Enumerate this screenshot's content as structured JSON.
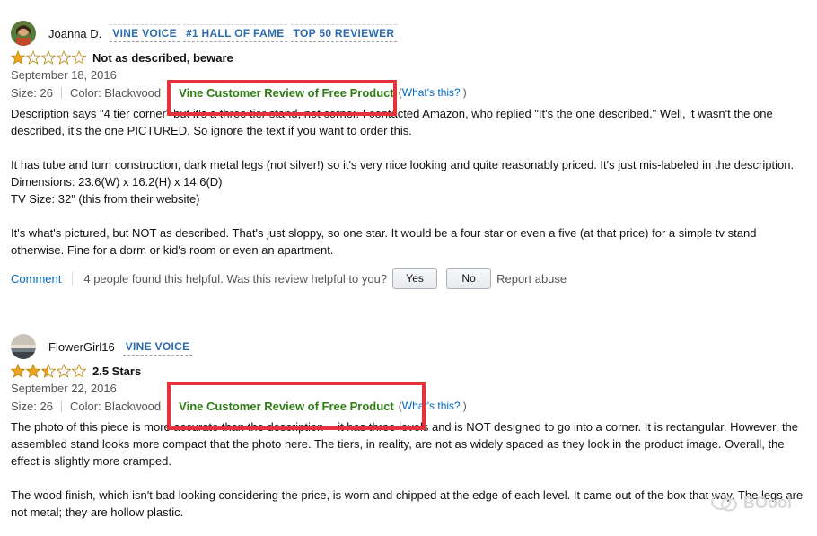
{
  "reviews": [
    {
      "username": "Joanna D.",
      "badges": [
        "VINE VOICE",
        "#1 HALL OF FAME",
        "TOP 50 REVIEWER"
      ],
      "rating": 1,
      "title": "Not as described, beware",
      "date": "September 18, 2016",
      "size": "Size: 26",
      "color": "Color: Blackwood",
      "vine_label": "Vine Customer Review of Free Product",
      "whats_this": "What's this?",
      "paragraphs": [
        "Description says \"4 tier corner\" but it's a three tier stand, not corner. I contacted Amazon, who replied \"It's the one described.\" Well, it wasn't the one described, it's the one PICTURED. So ignore the text if you want to order this.",
        "",
        "It has tube and turn construction, dark metal legs (not silver!) so it's very nice looking and quite reasonably priced. It's just mis-labeled in the description.",
        "Dimensions: 23.6(W) x 16.2(H) x 14.6(D)",
        "TV Size: 32\" (this from their website)",
        "",
        "It's what's pictured, but NOT as described. That's just sloppy, so one star. It would be a four star or even a five (at that price) for a simple tv stand otherwise. Fine for a dorm or kid's room or even an apartment."
      ],
      "comment": "Comment",
      "helpful_text": "4 people found this helpful. Was this review helpful to you?",
      "yes": "Yes",
      "no": "No",
      "report": "Report abuse"
    },
    {
      "username": "FlowerGirl16",
      "badges": [
        "VINE VOICE"
      ],
      "rating": 2.5,
      "title": "2.5 Stars",
      "date": "September 22, 2016",
      "size": "Size: 26",
      "color": "Color: Blackwood",
      "vine_label": "Vine Customer Review of Free Product",
      "whats_this": "What's this?",
      "paragraphs": [
        "The photo of this piece is more accurate than the description -- it has three levels and is NOT designed to go into a corner. It is rectangular. However, the assembled stand looks more compact that the photo here. The tiers, in reality, are not as widely spaced as they look in the product image. Overall, the effect is slightly more cramped.",
        "",
        "The wood finish, which isn't bad looking considering the price, is worn and chipped at the edge of each level. It came out of the box that way. The legs are not metal; they are hollow plastic."
      ]
    }
  ],
  "watermark": "BOool",
  "colors": {
    "link": "#0066c0",
    "badge": "#2a6ab0",
    "vine_green": "#2f7e14",
    "highlight_box": "#e5333d",
    "star": "#f0a41e"
  }
}
